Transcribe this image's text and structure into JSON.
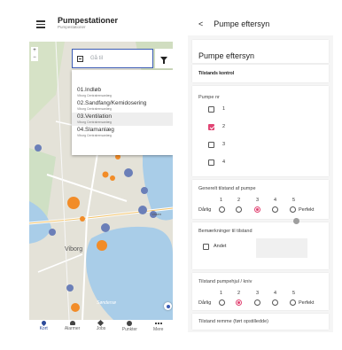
{
  "left": {
    "title": "Pumpestationer",
    "subtitle": "Pumpestationer",
    "zoom_in": "+",
    "zoom_out": "−",
    "search": {
      "placeholder": "Gå til"
    },
    "dropdown": [
      {
        "name": "01.Indløb",
        "sub": "Viborg Centralrensanlæg",
        "active": false
      },
      {
        "name": "02.Sandfang/Kemidosering",
        "sub": "Viborg Centralrensanlæg",
        "active": false
      },
      {
        "name": "03.Ventilation",
        "sub": "Viborg Centralrensanlæg",
        "active": true
      },
      {
        "name": "04.Slamanlæg",
        "sub": "Viborg Centralrensanlæg",
        "active": false
      }
    ],
    "map_labels": {
      "city": "Viborg",
      "lake": "Søndersø",
      "road": "Vasen"
    },
    "bottom_nav": [
      {
        "label": "Kort",
        "icon": "map-pin-icon",
        "selected": true
      },
      {
        "label": "Alarmer",
        "icon": "bell-icon",
        "selected": false
      },
      {
        "label": "Jobs",
        "icon": "wrench-icon",
        "selected": false
      },
      {
        "label": "Punkter",
        "icon": "dot-icon",
        "selected": false
      },
      {
        "label": "Mere",
        "icon": "more-icon",
        "selected": false
      }
    ]
  },
  "right": {
    "app_title": "Pumpe eftersyn",
    "card_title": "Pumpe eftersyn",
    "section": "Tilstands kontrol",
    "pumpe_label": "Pumpe nr",
    "pumps": [
      {
        "label": "1",
        "checked": false
      },
      {
        "label": "2",
        "checked": true
      },
      {
        "label": "3",
        "checked": false
      },
      {
        "label": "4",
        "checked": false
      }
    ],
    "general": {
      "label": "Generelt tilstand af pumpe",
      "low": "Dårlig",
      "high": "Perfekt",
      "scale": [
        "1",
        "2",
        "3",
        "4",
        "5"
      ],
      "selected": 3
    },
    "remarks": {
      "label": "Bemærkninger til tilstand",
      "option": "Andet"
    },
    "wheel": {
      "label": "Tilstand pumpehjul / kniv",
      "low": "Dårlig",
      "high": "Perfekt",
      "scale": [
        "1",
        "2",
        "3",
        "4",
        "5"
      ],
      "selected": 2
    },
    "belt": {
      "label": "Tilstand remme (ført opstilledde)"
    }
  },
  "colors": {
    "accent": "#e14473",
    "primary": "#2c4a9a",
    "marker": "#f28c28"
  }
}
